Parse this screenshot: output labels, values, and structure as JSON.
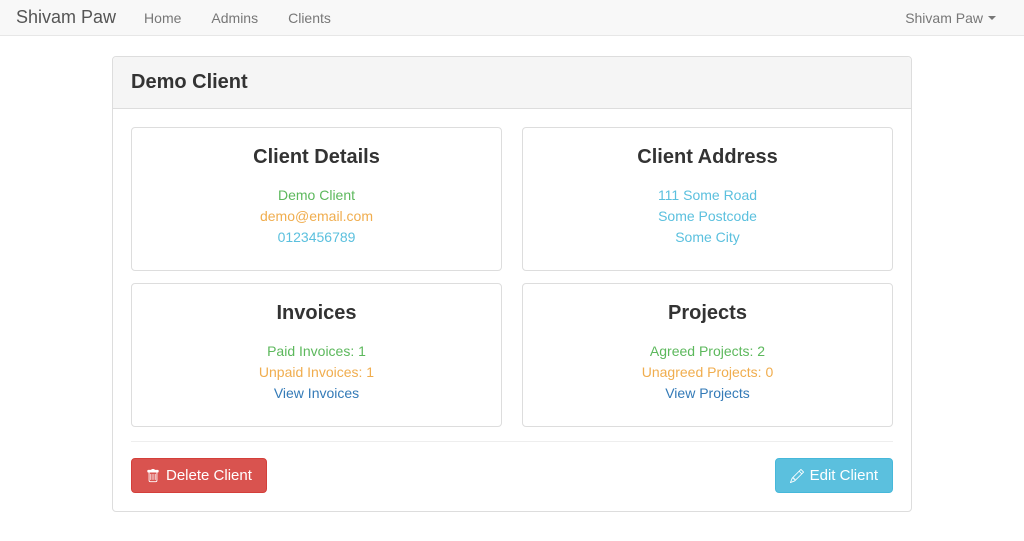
{
  "nav": {
    "brand": "Shivam Paw",
    "links": [
      "Home",
      "Admins",
      "Clients"
    ],
    "user": "Shivam Paw"
  },
  "page": {
    "title": "Demo Client"
  },
  "details": {
    "heading": "Client Details",
    "name": "Demo Client",
    "email": "demo@email.com",
    "phone": "0123456789"
  },
  "address": {
    "heading": "Client Address",
    "line1": "111 Some Road",
    "line2": "Some Postcode",
    "line3": "Some City"
  },
  "invoices": {
    "heading": "Invoices",
    "paid": "Paid Invoices: 1",
    "unpaid": "Unpaid Invoices: 1",
    "view": "View Invoices"
  },
  "projects": {
    "heading": "Projects",
    "agreed": "Agreed Projects: 2",
    "unagreed": "Unagreed Projects: 0",
    "view": "View Projects"
  },
  "actions": {
    "delete": "Delete Client",
    "edit": "Edit Client"
  }
}
